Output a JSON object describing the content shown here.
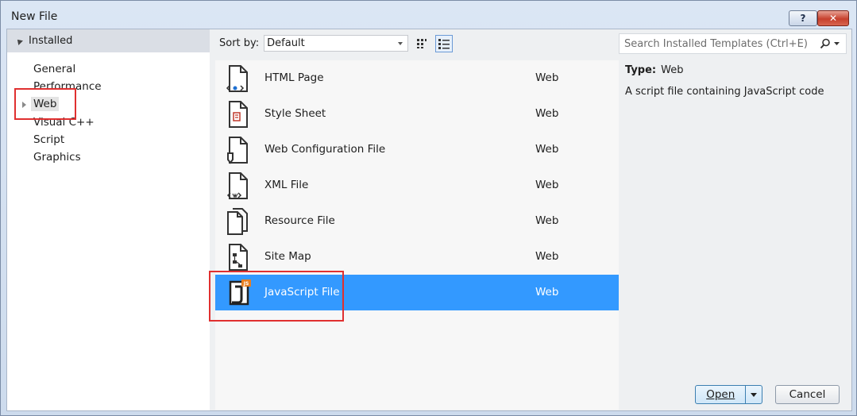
{
  "window": {
    "title": "New File",
    "help_label": "?",
    "close_label": "✕"
  },
  "left_panel": {
    "header": "Installed",
    "items": [
      {
        "label": "General"
      },
      {
        "label": "Performance"
      },
      {
        "label": "Web"
      },
      {
        "label": "Visual C++"
      },
      {
        "label": "Script"
      },
      {
        "label": "Graphics"
      }
    ]
  },
  "toolbar": {
    "sort_label": "Sort by:",
    "sort_value": "Default"
  },
  "search": {
    "placeholder": "Search Installed Templates (Ctrl+E)"
  },
  "templates": [
    {
      "name": "HTML Page",
      "category": "Web",
      "icon": "html-page-icon"
    },
    {
      "name": "Style Sheet",
      "category": "Web",
      "icon": "style-sheet-icon"
    },
    {
      "name": "Web Configuration File",
      "category": "Web",
      "icon": "web-config-icon"
    },
    {
      "name": "XML File",
      "category": "Web",
      "icon": "xml-file-icon"
    },
    {
      "name": "Resource File",
      "category": "Web",
      "icon": "resource-file-icon"
    },
    {
      "name": "Site Map",
      "category": "Web",
      "icon": "site-map-icon"
    },
    {
      "name": "JavaScript File",
      "category": "Web",
      "icon": "javascript-file-icon",
      "selected": true
    }
  ],
  "info": {
    "type_label": "Type:",
    "type_value": "Web",
    "description": "A script file containing JavaScript code"
  },
  "buttons": {
    "open": "Open",
    "cancel": "Cancel"
  },
  "colors": {
    "selection": "#3399ff",
    "highlight_box": "#e03030"
  }
}
